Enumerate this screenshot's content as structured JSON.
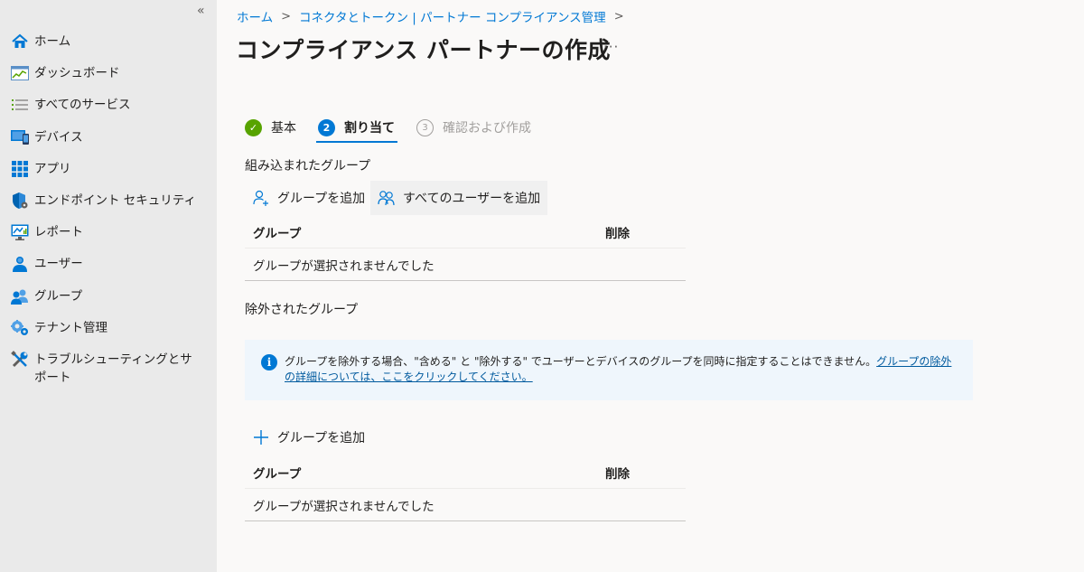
{
  "sidebar": {
    "collapse_label": "«",
    "items": [
      {
        "label": "ホーム",
        "icon": "home-icon"
      },
      {
        "label": "ダッシュボード",
        "icon": "dashboard-icon"
      },
      {
        "label": "すべてのサービス",
        "icon": "list-icon"
      },
      {
        "label": "デバイス",
        "icon": "devices-icon"
      },
      {
        "label": "アプリ",
        "icon": "apps-grid-icon"
      },
      {
        "label": "エンドポイント セキュリティ",
        "icon": "shield-icon"
      },
      {
        "label": "レポート",
        "icon": "reports-icon"
      },
      {
        "label": "ユーザー",
        "icon": "user-icon"
      },
      {
        "label": "グループ",
        "icon": "groups-icon"
      },
      {
        "label": "テナント管理",
        "icon": "tenant-admin-icon"
      },
      {
        "label": "トラブルシューティングとサポート",
        "icon": "wrench-icon"
      }
    ]
  },
  "breadcrumb": {
    "items": [
      "ホーム",
      "コネクタとトークン | パートナー コンプライアンス管理"
    ],
    "separator": ">"
  },
  "page": {
    "title": "コンプライアンス パートナーの作成",
    "more_label": "···"
  },
  "steps": [
    {
      "number": "✓",
      "label": "基本",
      "state": "done"
    },
    {
      "number": "2",
      "label": "割り当て",
      "state": "active"
    },
    {
      "number": "3",
      "label": "確認および作成",
      "state": "pending"
    }
  ],
  "included": {
    "title": "組み込まれたグループ",
    "add_group_label": "グループを追加",
    "add_all_users_label": "すべてのユーザーを追加",
    "columns": [
      "グループ",
      "削除"
    ],
    "empty_text": "グループが選択されませんでした"
  },
  "excluded": {
    "title": "除外されたグループ",
    "info_text": "グループを除外する場合、\"含める\" と \"除外する\" でユーザーとデバイスのグループを同時に指定することはできません。",
    "info_link": "グループの除外の詳細については、ここをクリックしてください。",
    "add_group_label": "グループを追加",
    "columns": [
      "グループ",
      "削除"
    ],
    "empty_text": "グループが選択されませんでした"
  },
  "colors": {
    "accent": "#0078d4",
    "success": "#57a300",
    "info_bg": "#eff6fc",
    "sidebar_bg": "#eaeaea"
  }
}
